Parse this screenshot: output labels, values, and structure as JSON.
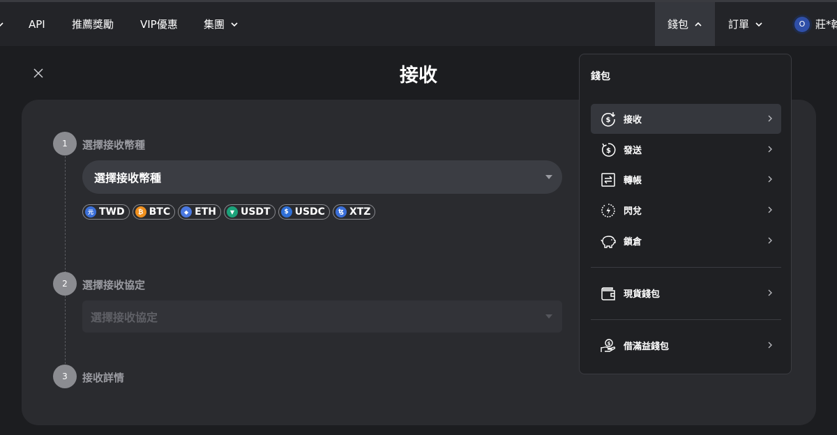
{
  "nav": {
    "items": [
      {
        "label": "API"
      },
      {
        "label": "推薦獎勵"
      },
      {
        "label": "VIP優惠"
      },
      {
        "label": "集團"
      }
    ],
    "wallet_label": "錢包",
    "orders_label": "訂單",
    "user": {
      "initial": "O",
      "name": "莊*翰"
    }
  },
  "page": {
    "title": "接收"
  },
  "steps": [
    {
      "number": "1",
      "label": "選擇接收幣種"
    },
    {
      "number": "2",
      "label": "選擇接收協定"
    },
    {
      "number": "3",
      "label": "接收詳情"
    }
  ],
  "coin_select": {
    "placeholder": "選擇接收幣種"
  },
  "protocol_select": {
    "placeholder": "選擇接收協定"
  },
  "coins": [
    {
      "symbol": "TWD",
      "icon": "twd-icon",
      "glyph": "元",
      "color": "#3b6fd8"
    },
    {
      "symbol": "BTC",
      "icon": "btc-icon",
      "glyph": "₿",
      "color": "#f0901e"
    },
    {
      "symbol": "ETH",
      "icon": "eth-icon",
      "glyph": "◆",
      "color": "#4a78e0"
    },
    {
      "symbol": "USDT",
      "icon": "usdt-icon",
      "glyph": "▼",
      "color": "#1ba27a"
    },
    {
      "symbol": "USDC",
      "icon": "usdc-icon",
      "glyph": "$",
      "color": "#2f6fd6"
    },
    {
      "symbol": "XTZ",
      "icon": "xtz-icon",
      "glyph": "ꜩ",
      "color": "#3a6ed8"
    }
  ],
  "dropdown": {
    "header": "錢包",
    "items": [
      {
        "label": "接收",
        "icon": "receive-icon"
      },
      {
        "label": "發送",
        "icon": "send-icon"
      },
      {
        "label": "轉帳",
        "icon": "transfer-icon"
      },
      {
        "label": "閃兌",
        "icon": "flash-swap-icon"
      },
      {
        "label": "鎖倉",
        "icon": "piggy-bank-icon"
      },
      {
        "label": "現貨錢包",
        "icon": "wallet-icon"
      },
      {
        "label": "借滿益錢包",
        "icon": "lending-wallet-icon"
      }
    ]
  }
}
